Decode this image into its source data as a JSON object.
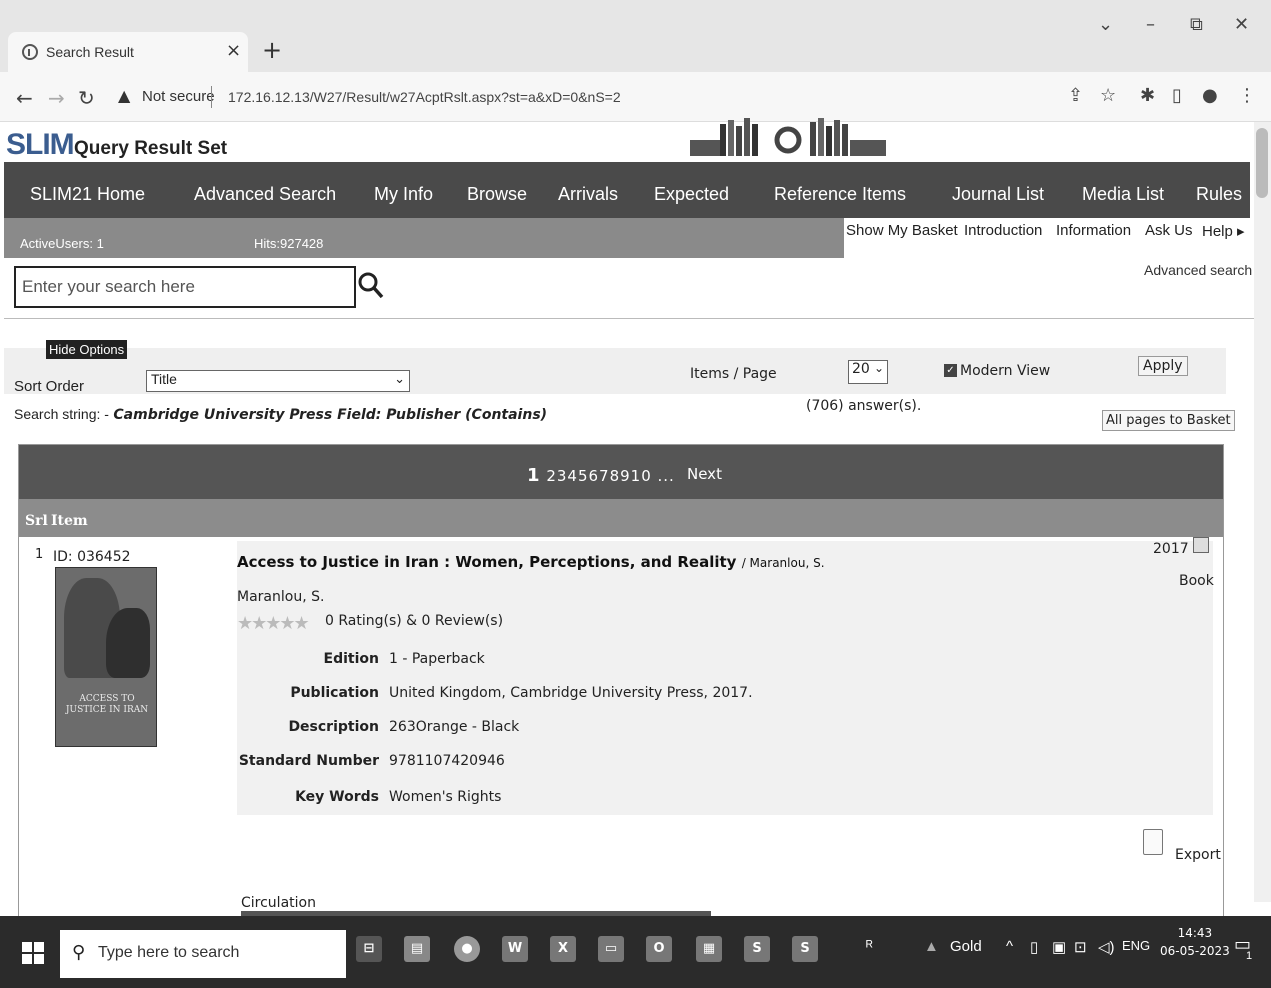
{
  "browser": {
    "tab_title": "Search Result",
    "tab_close": "×",
    "new_tab": "+",
    "not_secure": "Not secure",
    "url": "172.16.12.13/W27/Result/w27AcptRslt.aspx?st=a&xD=0&nS=2"
  },
  "app": {
    "logo": "SLIM",
    "title": "Query Result Set"
  },
  "menu": [
    "SLIM21 Home",
    "Advanced Search",
    "My Info",
    "Browse",
    "Arrivals",
    "Expected",
    "Reference Items",
    "Journal List",
    "Media List",
    "Rules"
  ],
  "status": {
    "active_users": "ActiveUsers: 1",
    "hits": "Hits:927428"
  },
  "sublinks": [
    "Show My Basket",
    "Introduction",
    "Information",
    "Ask Us",
    "Help ▸"
  ],
  "search": {
    "placeholder": "Enter your search here",
    "advanced_link": "Advanced search"
  },
  "options": {
    "hide_label": "Hide Options",
    "sort_label": "Sort Order",
    "sort_value": "Title",
    "items_label": "Items / Page",
    "items_value": "20",
    "modern_view_label": "Modern View",
    "modern_view_checked": true,
    "apply_label": "Apply"
  },
  "query": {
    "prefix": "Search string: -",
    "string": "Cambridge University Press Field: Publisher (Contains)",
    "answers": "(706) answer(s).",
    "basket_button": "All pages to Basket"
  },
  "results": {
    "current_page": "1",
    "other_pages": "2345678910 ...",
    "next": "Next",
    "col_srl": "Srl",
    "col_item": "Item",
    "record": {
      "number": "1",
      "id": "ID:  036452",
      "cover_text": "ACCESS TO JUSTICE IN IRAN",
      "title": "Access to Justice in Iran : Women, Perceptions, and Reality",
      "title_author": " / Maranlou, S.",
      "author": "Maranlou, S.",
      "stars": "★★★★★",
      "rating_score": 0,
      "ratings": "0 Rating(s) & 0 Review(s)",
      "year": "2017",
      "type": "Book",
      "fields": [
        {
          "label": "Edition",
          "value": "1 - Paperback"
        },
        {
          "label": "Publication",
          "value": "United Kingdom, Cambridge University Press, 2017."
        },
        {
          "label": "Description",
          "value": "263Orange - Black"
        },
        {
          "label": "Standard Number",
          "value": "9781107420946"
        },
        {
          "label": "Key Words",
          "value": "Women's Rights"
        }
      ],
      "export": "Export",
      "circulation": "Circulation"
    }
  },
  "taskbar": {
    "search_text": "Type here to search",
    "gold": "Gold",
    "lang": "ENG",
    "time": "14:43",
    "date": "06-05-2023",
    "notif_count": "1"
  }
}
